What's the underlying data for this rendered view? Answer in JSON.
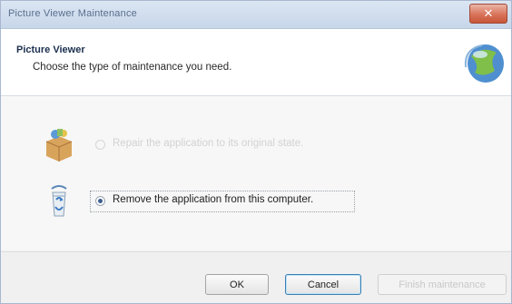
{
  "window": {
    "title": "Picture Viewer Maintenance",
    "close_label": "✕"
  },
  "header": {
    "title": "Picture Viewer",
    "subtitle": "Choose the type of maintenance you need."
  },
  "options": [
    {
      "label": "Repair the application to its original state.",
      "selected": false,
      "enabled": false
    },
    {
      "label": "Remove the application from this computer.",
      "selected": true,
      "enabled": true
    }
  ],
  "footer": {
    "ok_label": "OK",
    "cancel_label": "Cancel",
    "finish_label": "Finish maintenance"
  },
  "colors": {
    "accent": "#3c7fb1",
    "titlebar": "#c7d6ea",
    "close": "#d9735a"
  },
  "icons": {
    "header": "globe-app-icon",
    "repair": "package-box-icon",
    "remove": "recycle-bin-icon"
  }
}
